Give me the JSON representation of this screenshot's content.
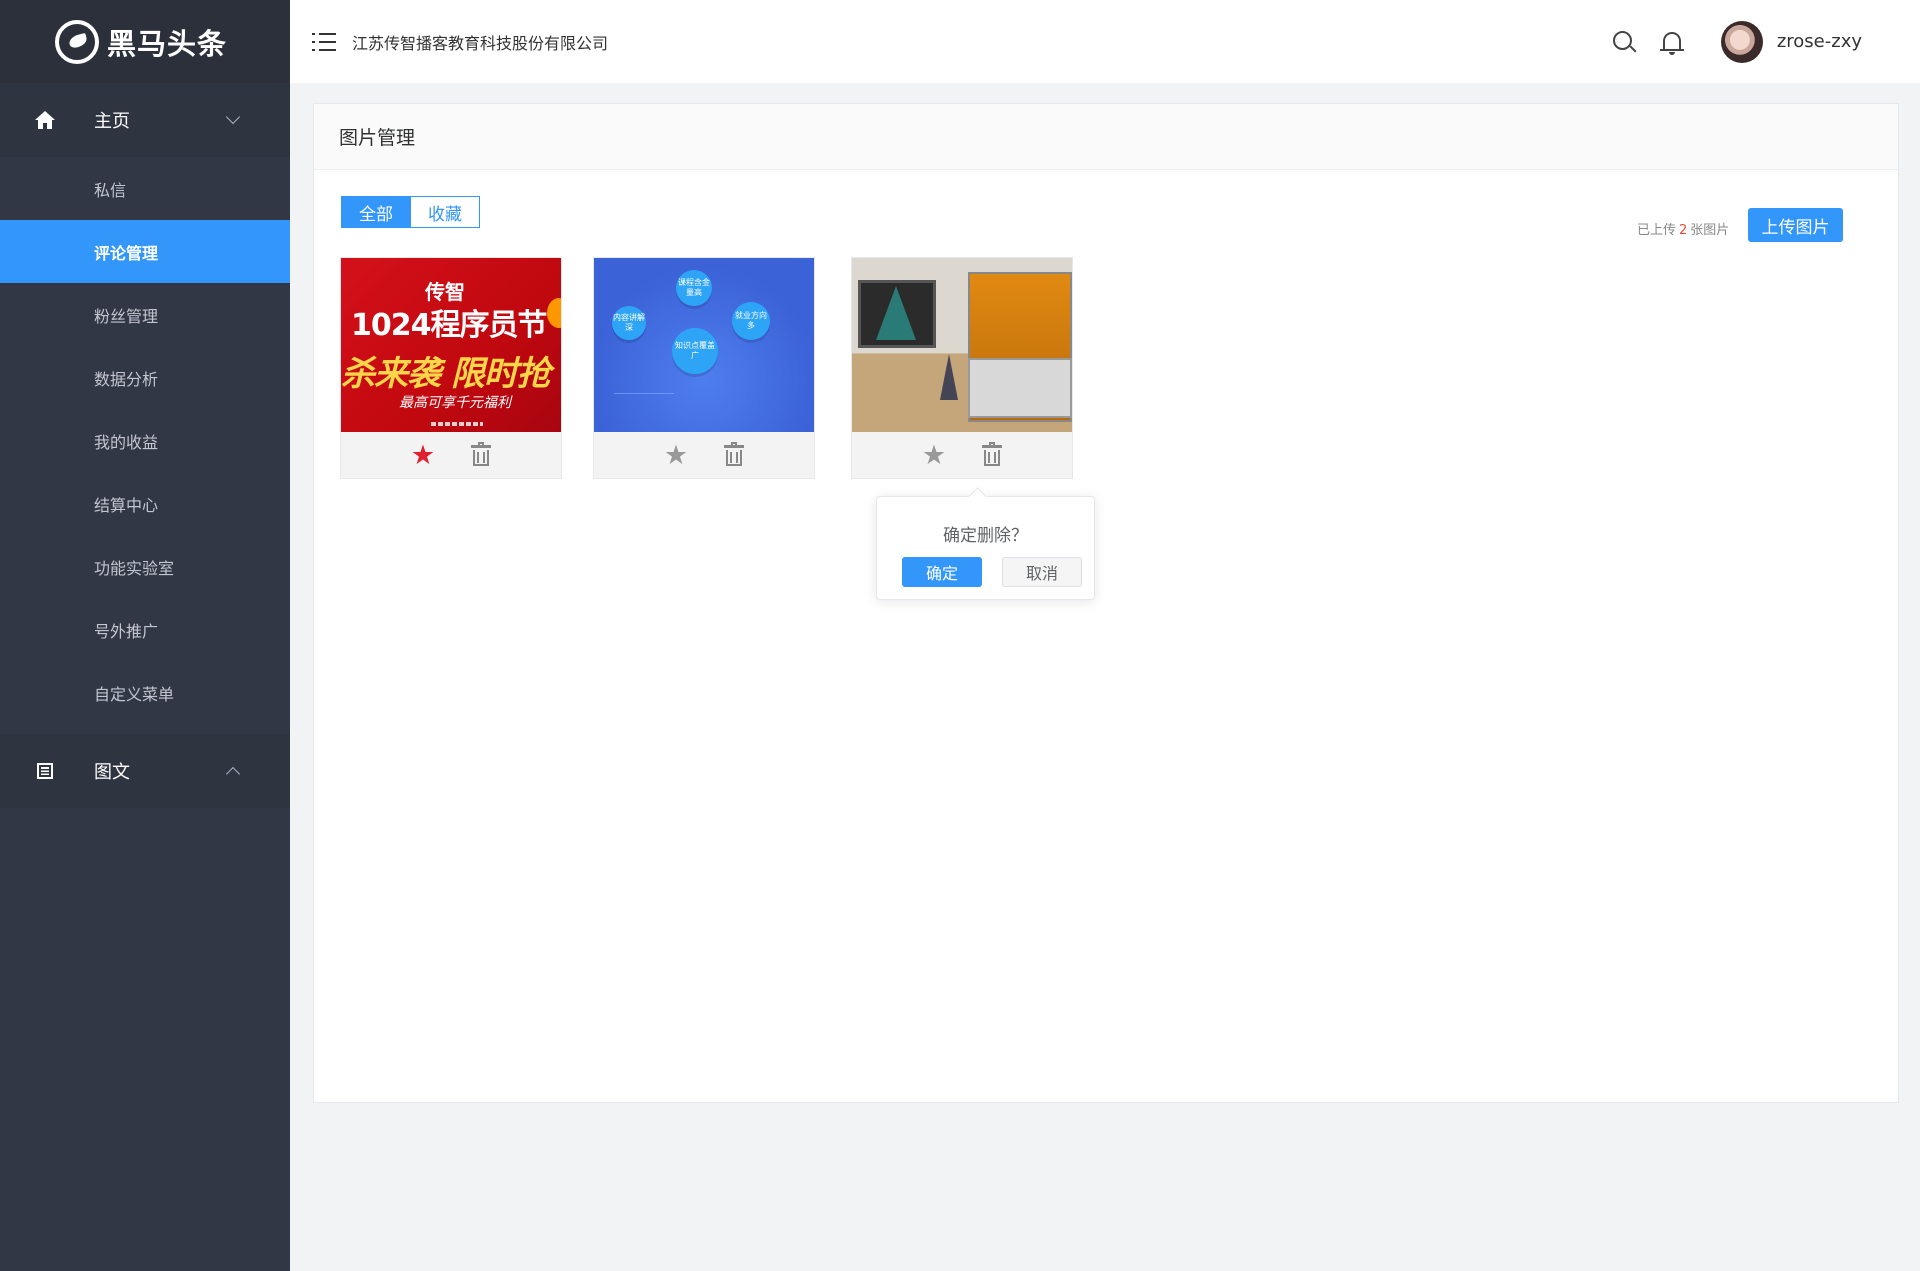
{
  "sidebar": {
    "logo_text": "黑马头条",
    "groups": [
      {
        "label": "主页",
        "icon": "home-icon",
        "expanded": true
      },
      {
        "label": "图文",
        "icon": "article-icon",
        "expanded": true
      }
    ],
    "items": [
      {
        "label": "私信"
      },
      {
        "label": "评论管理"
      },
      {
        "label": "粉丝管理"
      },
      {
        "label": "数据分析"
      },
      {
        "label": "我的收益"
      },
      {
        "label": "结算中心"
      },
      {
        "label": "功能实验室"
      },
      {
        "label": "号外推广"
      },
      {
        "label": "自定义菜单"
      }
    ],
    "active_item": "评论管理",
    "colors": {
      "bg": "#323745",
      "active": "#3296fa"
    }
  },
  "header": {
    "menu_icon": "hamburger-icon",
    "company": "江苏传智播客教育科技股份有限公司",
    "search_icon": "search-icon",
    "bell_icon": "bell-icon",
    "username": "zrose-zxy"
  },
  "card": {
    "title": "图片管理",
    "tabs": [
      {
        "label": "全部",
        "active": true
      },
      {
        "label": "收藏",
        "active": false
      }
    ],
    "upload_info": {
      "prefix": "已上传",
      "count": "2",
      "suffix": "张图片"
    },
    "upload_button": "上传图片",
    "images": [
      {
        "alt": "1024程序员节 banner",
        "favorited": true,
        "text": {
          "line1": "传智",
          "line2": "1024程序员节",
          "line3": "杀来袭 限时抢",
          "line4": "最高可享千元福利"
        }
      },
      {
        "alt": "course bubbles banner",
        "favorited": false,
        "bubbles": [
          "课程含金量高",
          "内容讲解深",
          "就业方向多",
          "知识点覆盖广"
        ]
      },
      {
        "alt": "3D printer photo",
        "favorited": false
      }
    ]
  },
  "popconfirm": {
    "title": "确定删除？",
    "confirm": "确定",
    "cancel": "取消"
  },
  "colors": {
    "primary": "#3296fa",
    "favorite": "#e0202e",
    "count": "#e74c3c"
  }
}
